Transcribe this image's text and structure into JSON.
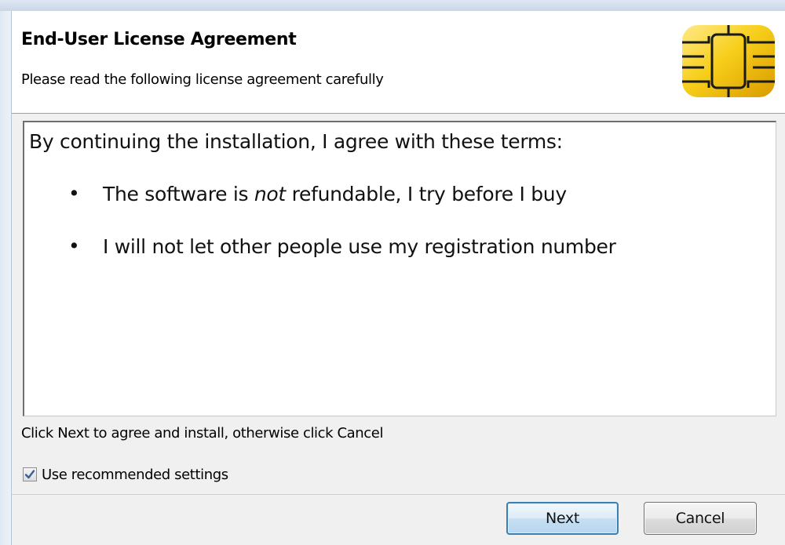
{
  "header": {
    "title": "End-User License Agreement",
    "subtitle": "Please read the following license agreement carefully",
    "logo_icon": "smart-card-chip-icon"
  },
  "license": {
    "intro": "By continuing the installation, I agree with these terms:",
    "terms": [
      {
        "bullet": "•",
        "before": "The software is ",
        "emphasis": "not",
        "after": " refundable, I try before I buy"
      },
      {
        "bullet": "•",
        "before": "I will not let other people use my registration number",
        "emphasis": "",
        "after": ""
      }
    ]
  },
  "hint": "Click Next to agree and install, otherwise click Cancel",
  "options": {
    "recommended_settings": {
      "label": "Use recommended settings",
      "checked": true
    }
  },
  "buttons": {
    "next_label": "Next",
    "cancel_label": "Cancel"
  },
  "colors": {
    "chip_gold": "#f2c200",
    "focus_border": "#3c7fb1",
    "check_mark": "#3a5f9a"
  }
}
